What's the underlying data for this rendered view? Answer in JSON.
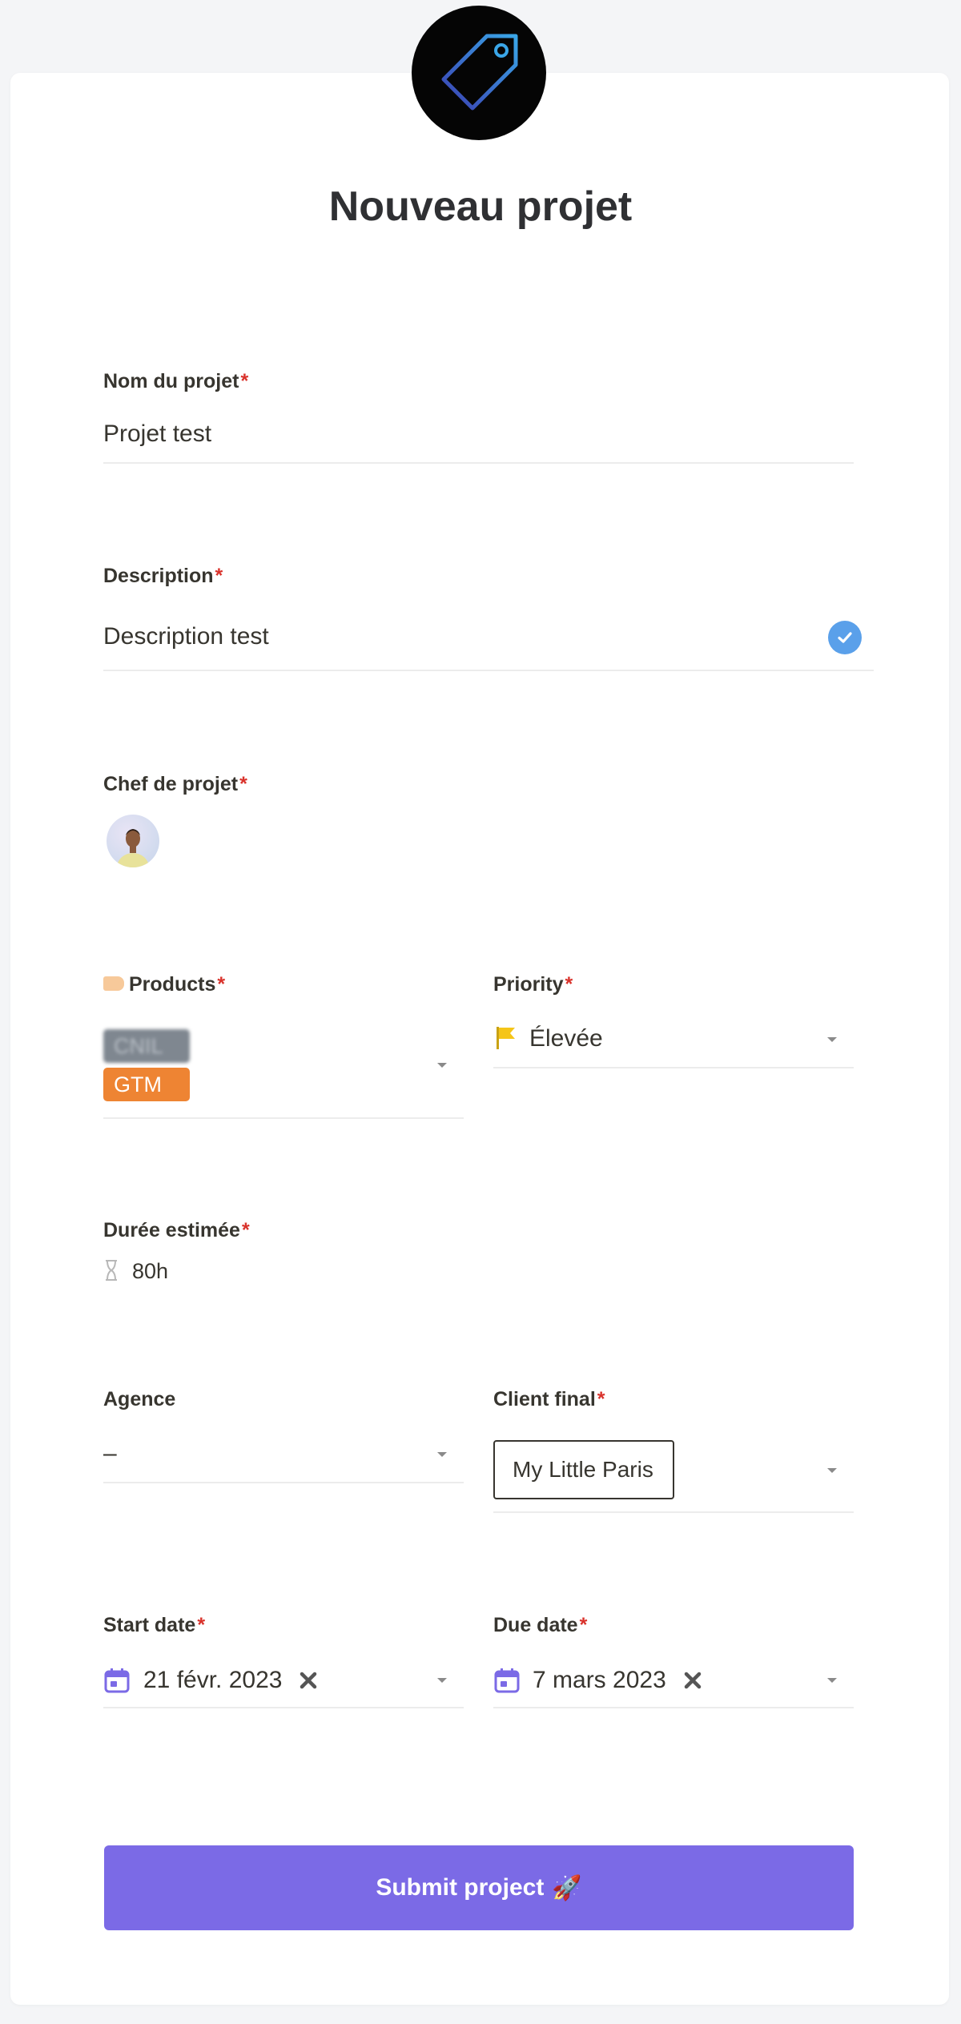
{
  "page": {
    "title": "Nouveau projet",
    "required_marker": "*"
  },
  "colors": {
    "accent": "#7b6ae6",
    "required": "#d9322b",
    "check": "#5aa0ea",
    "tag_gtm": "#ee8433",
    "priority_flag": "#f5c518",
    "calendar": "#7b6ae6"
  },
  "fields": {
    "project_name": {
      "label": "Nom du projet",
      "value": "Projet test"
    },
    "description": {
      "label": "Description",
      "value": "Description test"
    },
    "project_lead": {
      "label": "Chef de projet",
      "avatar_icon": "user-avatar"
    },
    "products": {
      "label": "Products",
      "icon": "tag-emoji-icon",
      "tags": [
        "CNIL",
        "GTM"
      ]
    },
    "priority": {
      "label": "Priority",
      "value": "Élevée",
      "icon": "flag-icon"
    },
    "estimated_duration": {
      "label": "Durée estimée",
      "value": "80h",
      "icon": "hourglass-icon"
    },
    "agency": {
      "label": "Agence",
      "value": "–"
    },
    "end_client": {
      "label": "Client final",
      "value": "My Little Paris"
    },
    "start_date": {
      "label": "Start date",
      "value": "21 févr. 2023",
      "icon": "calendar-icon"
    },
    "due_date": {
      "label": "Due date",
      "value": "7 mars 2023",
      "icon": "calendar-icon"
    }
  },
  "submit": {
    "label": "Submit project",
    "emoji": "🚀"
  }
}
